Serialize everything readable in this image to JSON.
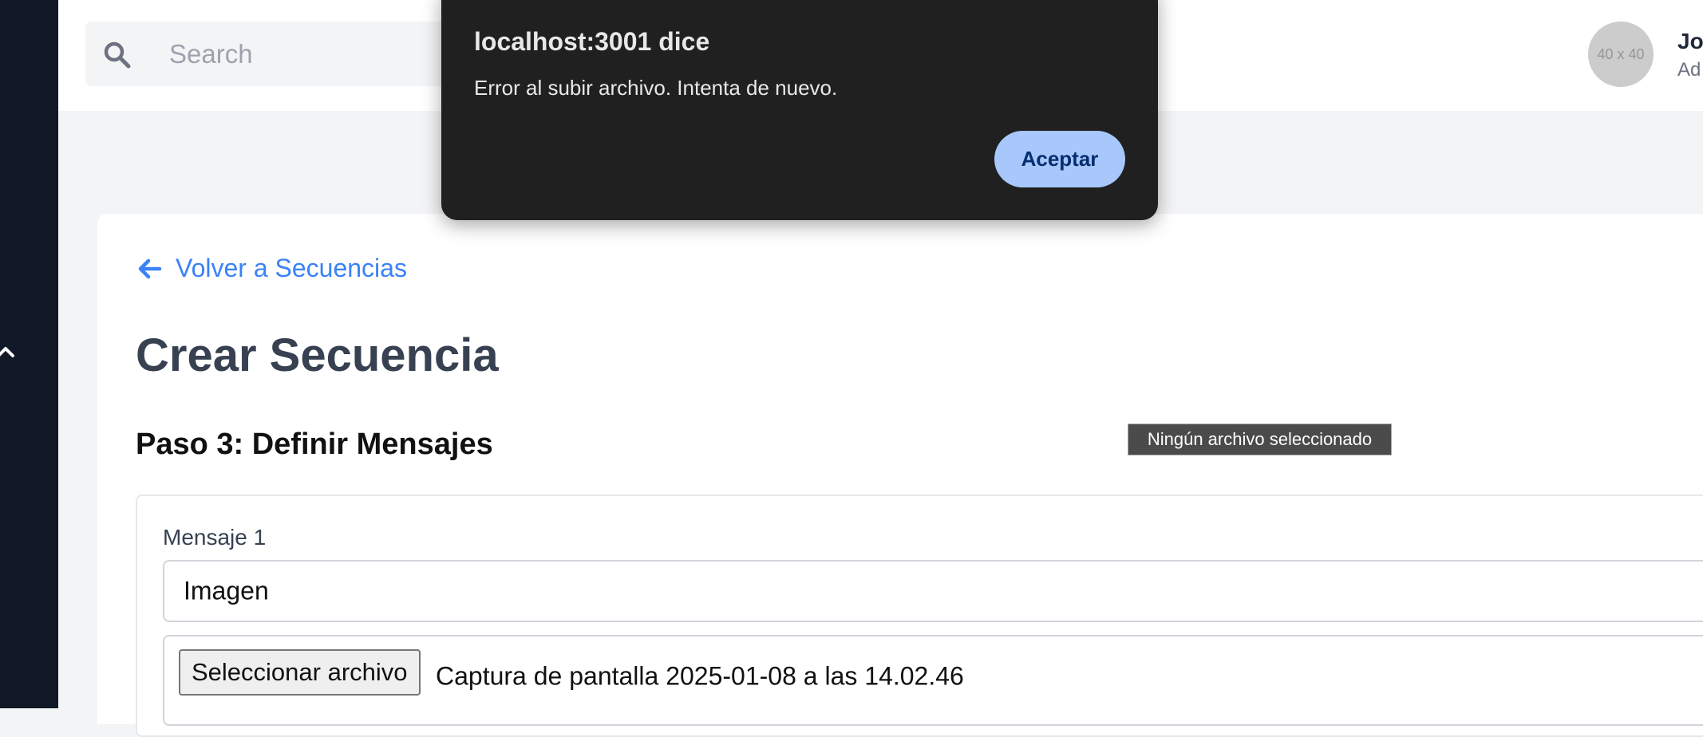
{
  "header": {
    "search": {
      "placeholder": "Search"
    },
    "user": {
      "avatar_text": "40 x 40",
      "name": "Jo",
      "role": "Ad"
    }
  },
  "main": {
    "back_link": "Volver a Secuencias",
    "title": "Crear Secuencia",
    "step_title": "Paso 3: Definir Mensajes",
    "messages": [
      {
        "label": "Mensaje 1",
        "type_value": "Imagen",
        "file_button": "Seleccionar archivo",
        "file_name": "Captura de pantalla 2025-01-08 a las 14.02.46"
      }
    ]
  },
  "tooltip": "Ningún archivo seleccionado",
  "dialog": {
    "title": "localhost:3001 dice",
    "message": "Error al subir archivo. Intenta de nuevo.",
    "ok_label": "Aceptar"
  },
  "colors": {
    "sidebar": "#111827",
    "link": "#3b82f6",
    "dialog_bg": "#202020",
    "dialog_button": "#a8c7fa"
  },
  "icons": {
    "sidebar_toggle": "chevron-up-icon",
    "search": "search-icon",
    "back": "arrow-left-icon"
  }
}
